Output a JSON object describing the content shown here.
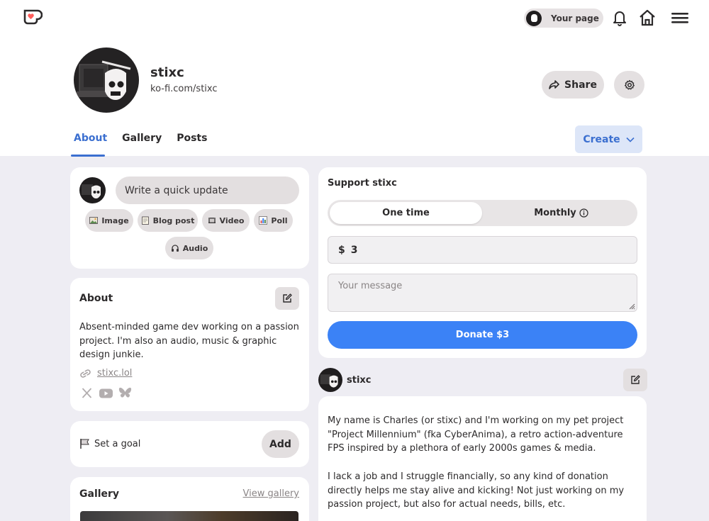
{
  "colors": {
    "accent": "#3b6fd0",
    "donate": "#3b82f6",
    "page_bg": "#eeedf3",
    "logo_red": "#ff5e5b"
  },
  "header": {
    "your_page_label": "Your page",
    "icons": [
      "kofi-logo-icon",
      "bell-icon",
      "home-icon",
      "hamburger-menu-icon"
    ]
  },
  "profile": {
    "name": "stixc",
    "url": "ko-fi.com/stixc",
    "share_label": "Share",
    "settings_icon": "gear-icon"
  },
  "tabs": [
    {
      "label": "About",
      "active": true
    },
    {
      "label": "Gallery",
      "active": false
    },
    {
      "label": "Posts",
      "active": false
    }
  ],
  "create_label": "Create",
  "update": {
    "placeholder": "Write a quick update",
    "actions": [
      {
        "label": "Image",
        "icon": "image-icon"
      },
      {
        "label": "Blog post",
        "icon": "notepad-icon"
      },
      {
        "label": "Video",
        "icon": "film-icon"
      },
      {
        "label": "Poll",
        "icon": "bar-chart-icon"
      },
      {
        "label": "Audio",
        "icon": "headphones-icon"
      }
    ]
  },
  "about": {
    "title": "About",
    "text": "Absent-minded game dev working on a passion project. I'm also an audio, music & graphic design junkie.",
    "link": "stixc.lol",
    "socials": [
      "x-icon",
      "youtube-icon",
      "bluesky-icon"
    ]
  },
  "goal": {
    "label": "Set a goal",
    "add_label": "Add"
  },
  "gallery": {
    "title": "Gallery",
    "view_label": "View gallery"
  },
  "support": {
    "title": "Support stixc",
    "one_time": "One time",
    "monthly": "Monthly",
    "currency": "$",
    "amount": "3",
    "message_placeholder": "Your message",
    "donate_label": "Donate $3"
  },
  "post": {
    "author": "stixc",
    "paragraphs": [
      "My name is Charles (or stixc) and I'm working on my pet project \"Project Millennium\" (fka CyberAnima), a retro action-adventure FPS inspired by a plethora of early 2000s games & media.",
      "I lack a job and I struggle financially, so any kind of donation directly helps me stay alive and kicking! Not just working on my passion project, but also for actual needs, bills, etc."
    ]
  }
}
